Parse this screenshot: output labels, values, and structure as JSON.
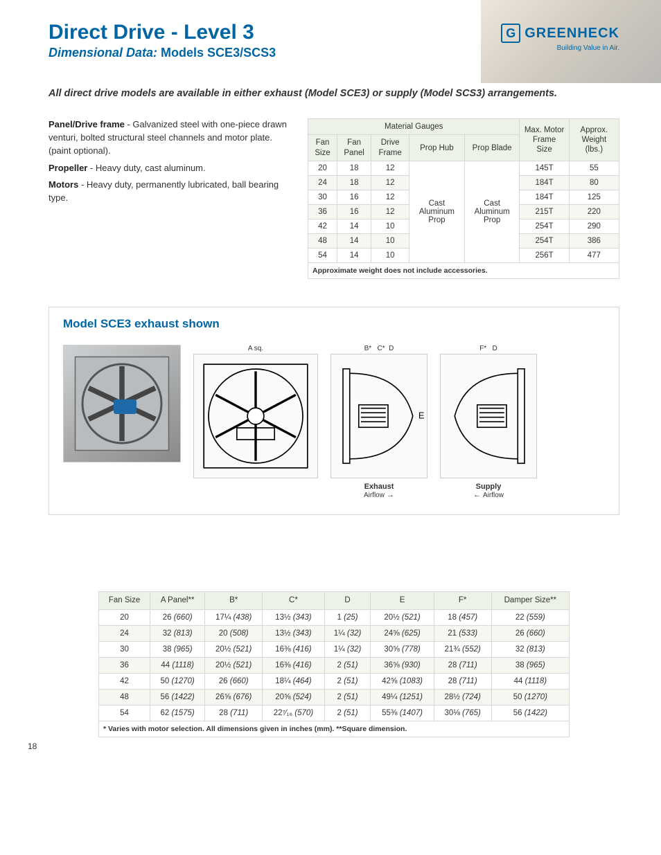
{
  "header": {
    "title": "Direct Drive - Level 3",
    "subtitle_prefix": "Dimensional Data: ",
    "subtitle_models": "Models SCE3/SCS3",
    "brand": "GREENHECK",
    "tagline": "Building Value in Air."
  },
  "intro": "All direct drive models are available in either exhaust (Model SCE3) or supply (Model SCS3) arrangements.",
  "specs": {
    "panel_label": "Panel/Drive frame",
    "panel_text": " - Galvanized steel with one-piece drawn venturi, bolted structural steel channels and motor plate. (paint optional).",
    "prop_label": "Propeller",
    "prop_text": " - Heavy duty, cast aluminum.",
    "motor_label": "Motors",
    "motor_text": " - Heavy duty, permanently lubricated, ball bearing type."
  },
  "gauge_table": {
    "group_header": "Material Gauges",
    "cols": {
      "fan_size": "Fan Size",
      "fan_panel": "Fan Panel",
      "drive_frame": "Drive Frame",
      "prop_hub": "Prop Hub",
      "prop_blade": "Prop Blade",
      "motor": "Max. Motor Frame Size",
      "weight": "Approx. Weight (lbs.)"
    },
    "hub_value": "Cast Aluminum Prop",
    "blade_value": "Cast Aluminum Prop",
    "rows": [
      {
        "size": "20",
        "panel": "18",
        "drive": "12",
        "motor": "145T",
        "wt": "55"
      },
      {
        "size": "24",
        "panel": "18",
        "drive": "12",
        "motor": "184T",
        "wt": "80"
      },
      {
        "size": "30",
        "panel": "16",
        "drive": "12",
        "motor": "184T",
        "wt": "125"
      },
      {
        "size": "36",
        "panel": "16",
        "drive": "12",
        "motor": "215T",
        "wt": "220"
      },
      {
        "size": "42",
        "panel": "14",
        "drive": "10",
        "motor": "254T",
        "wt": "290"
      },
      {
        "size": "48",
        "panel": "14",
        "drive": "10",
        "motor": "254T",
        "wt": "386"
      },
      {
        "size": "54",
        "panel": "14",
        "drive": "10",
        "motor": "256T",
        "wt": "477"
      }
    ],
    "note": "Approximate weight does not include accessories."
  },
  "diagram": {
    "title": "Model SCE3 exhaust shown",
    "labels": {
      "asq": "A sq.",
      "b": "B*",
      "c": "C*",
      "d": "D",
      "e": "E",
      "f": "F*"
    },
    "exhaust_label": "Exhaust",
    "supply_label": "Supply",
    "airflow": "Airflow"
  },
  "dim_table": {
    "cols": {
      "size": "Fan Size",
      "a": "A Panel**",
      "b": "B*",
      "c": "C*",
      "d": "D",
      "e": "E",
      "f": "F*",
      "damper": "Damper Size**"
    },
    "rows": [
      {
        "size": "20",
        "a": "26",
        "am": "(660)",
        "b": "17¼",
        "bm": "(438)",
        "c": "13½",
        "cm": "(343)",
        "d": "1",
        "dm": "(25)",
        "e": "20½",
        "em": "(521)",
        "f": "18",
        "fm": "(457)",
        "dp": "22",
        "dpm": "(559)"
      },
      {
        "size": "24",
        "a": "32",
        "am": "(813)",
        "b": "20",
        "bm": "(508)",
        "c": "13½",
        "cm": "(343)",
        "d": "1¼",
        "dm": "(32)",
        "e": "24⅝",
        "em": "(625)",
        "f": "21",
        "fm": "(533)",
        "dp": "26",
        "dpm": "(660)"
      },
      {
        "size": "30",
        "a": "38",
        "am": "(965)",
        "b": "20½",
        "bm": "(521)",
        "c": "16⅜",
        "cm": "(416)",
        "d": "1¼",
        "dm": "(32)",
        "e": "30⅝",
        "em": "(778)",
        "f": "21¾",
        "fm": "(552)",
        "dp": "32",
        "dpm": "(813)"
      },
      {
        "size": "36",
        "a": "44",
        "am": "(1118)",
        "b": "20½",
        "bm": "(521)",
        "c": "16⅜",
        "cm": "(416)",
        "d": "2",
        "dm": "(51)",
        "e": "36⅝",
        "em": "(930)",
        "f": "28",
        "fm": "(711)",
        "dp": "38",
        "dpm": "(965)"
      },
      {
        "size": "42",
        "a": "50",
        "am": "(1270)",
        "b": "26",
        "bm": "(660)",
        "c": "18¼",
        "cm": "(464)",
        "d": "2",
        "dm": "(51)",
        "e": "42⅝",
        "em": "(1083)",
        "f": "28",
        "fm": "(711)",
        "dp": "44",
        "dpm": "(1118)"
      },
      {
        "size": "48",
        "a": "56",
        "am": "(1422)",
        "b": "26⅝",
        "bm": "(676)",
        "c": "20⅝",
        "cm": "(524)",
        "d": "2",
        "dm": "(51)",
        "e": "49¼",
        "em": "(1251)",
        "f": "28½",
        "fm": "(724)",
        "dp": "50",
        "dpm": "(1270)"
      },
      {
        "size": "54",
        "a": "62",
        "am": "(1575)",
        "b": "28",
        "bm": "(711)",
        "c": "22⁷⁄₁₆",
        "cm": "(570)",
        "d": "2",
        "dm": "(51)",
        "e": "55⅜",
        "em": "(1407)",
        "f": "30⅛",
        "fm": "(765)",
        "dp": "56",
        "dpm": "(1422)"
      }
    ],
    "note": "* Varies with motor selection. All dimensions given in inches (mm). **Square dimension."
  },
  "page_number": "18"
}
